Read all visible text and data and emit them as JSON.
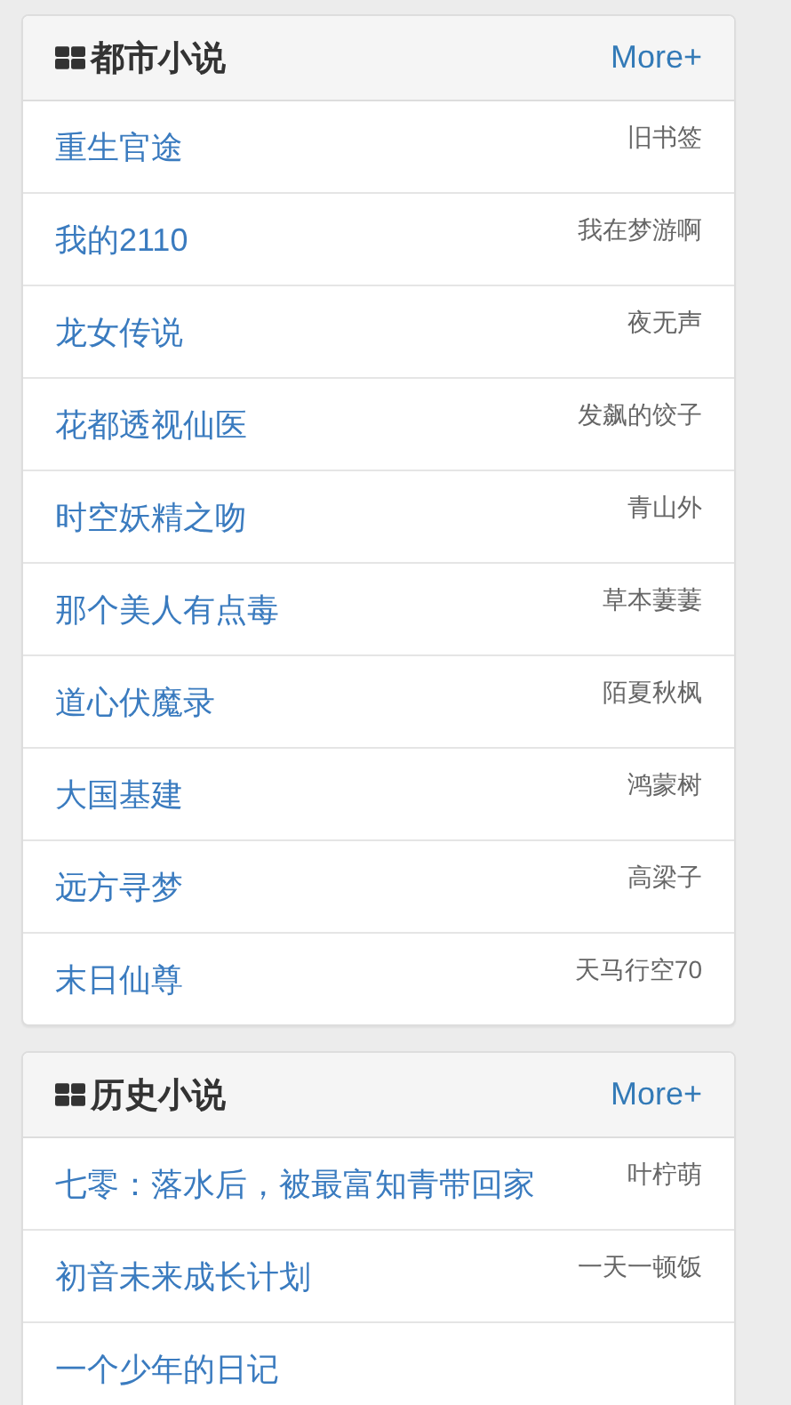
{
  "panels": [
    {
      "title": "都市小说",
      "more": "More+",
      "books": [
        {
          "title": "重生官途",
          "author": "旧书签"
        },
        {
          "title": "我的2110",
          "author": "我在梦游啊"
        },
        {
          "title": "龙女传说",
          "author": "夜无声"
        },
        {
          "title": "花都透视仙医",
          "author": "发飙的饺子"
        },
        {
          "title": "时空妖精之吻",
          "author": "青山外"
        },
        {
          "title": "那个美人有点毒",
          "author": "草本萋萋"
        },
        {
          "title": "道心伏魔录",
          "author": "陌夏秋枫"
        },
        {
          "title": "大国基建",
          "author": "鸿蒙树"
        },
        {
          "title": "远方寻梦",
          "author": "高梁子"
        },
        {
          "title": "末日仙尊",
          "author": "天马行空70"
        }
      ]
    },
    {
      "title": "历史小说",
      "more": "More+",
      "books": [
        {
          "title": "七零：落水后，被最富知青带回家",
          "author": "叶柠萌"
        },
        {
          "title": "初音未来成长计划",
          "author": "一天一顿饭"
        },
        {
          "title": "一个少年的日记"
        }
      ]
    }
  ]
}
